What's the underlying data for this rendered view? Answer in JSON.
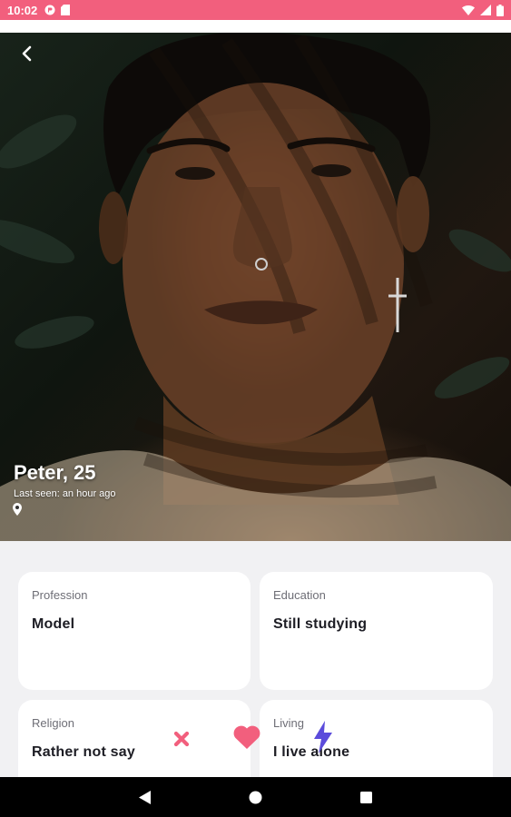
{
  "status_bar": {
    "time": "10:02"
  },
  "profile": {
    "name": "Peter, 25",
    "last_seen": "Last seen: an hour ago"
  },
  "cards": [
    {
      "label": "Profession",
      "value": "Model"
    },
    {
      "label": "Education",
      "value": "Still studying"
    },
    {
      "label": "Religion",
      "value": "Rather not say"
    },
    {
      "label": "Living",
      "value": "I live alone"
    }
  ],
  "colors": {
    "accent": "#f25f7d",
    "boost": "#5b4bdb",
    "status_bar": "#f25f7d"
  },
  "icons": {
    "back": "chevron-left-icon",
    "location": "location-pin-icon",
    "dislike": "close-icon",
    "like": "heart-icon",
    "boost": "lightning-icon"
  }
}
